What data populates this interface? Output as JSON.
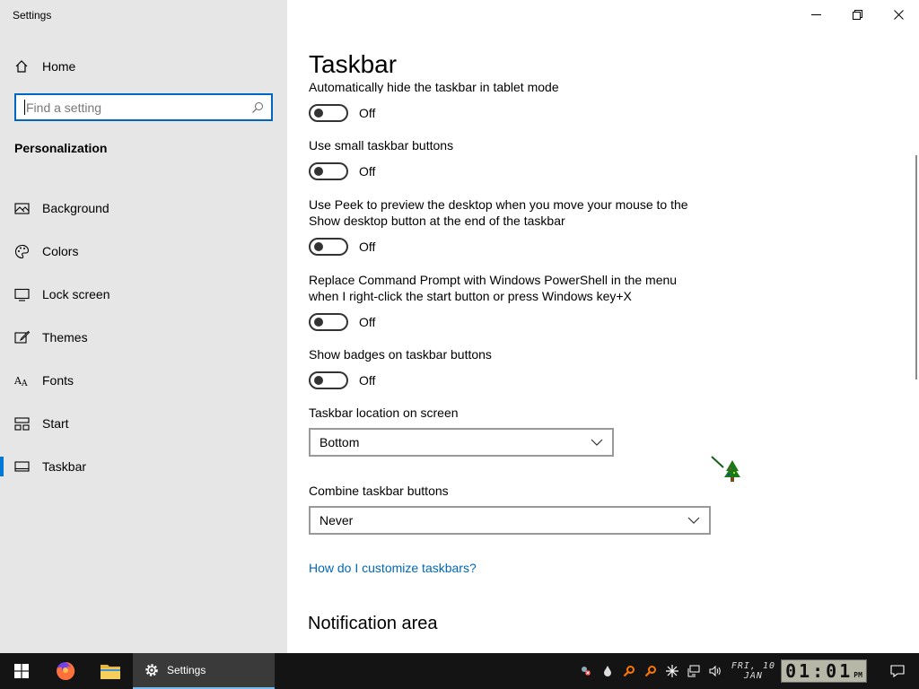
{
  "window": {
    "title": "Settings"
  },
  "sidebar": {
    "home_label": "Home",
    "search_placeholder": "Find a setting",
    "section_title": "Personalization",
    "items": [
      {
        "label": "Background",
        "icon": "image-icon"
      },
      {
        "label": "Colors",
        "icon": "palette-icon"
      },
      {
        "label": "Lock screen",
        "icon": "monitor-lock-icon"
      },
      {
        "label": "Themes",
        "icon": "brush-icon"
      },
      {
        "label": "Fonts",
        "icon": "font-icon"
      },
      {
        "label": "Start",
        "icon": "start-grid-icon"
      },
      {
        "label": "Taskbar",
        "icon": "taskbar-icon",
        "active": true
      }
    ]
  },
  "main": {
    "title": "Taskbar",
    "settings": [
      {
        "label": "Automatically hide the taskbar in tablet mode",
        "state": "Off"
      },
      {
        "label": "Use small taskbar buttons",
        "state": "Off"
      },
      {
        "label": "Use Peek to preview the desktop when you move your mouse to the Show desktop button at the end of the taskbar",
        "state": "Off"
      },
      {
        "label": "Replace Command Prompt with Windows PowerShell in the menu when I right-click the start button or press Windows key+X",
        "state": "Off"
      },
      {
        "label": "Show badges on taskbar buttons",
        "state": "Off"
      }
    ],
    "location_label": "Taskbar location on screen",
    "location_value": "Bottom",
    "combine_label": "Combine taskbar buttons",
    "combine_value": "Never",
    "help_link": "How do I customize taskbars?",
    "notification_heading": "Notification area"
  },
  "taskbar": {
    "active_app_label": "Settings",
    "date_day": "FRI, 10",
    "date_month": "JAN",
    "clock_time": "01:01",
    "clock_ampm": "PM",
    "accent": "#0078d7"
  }
}
